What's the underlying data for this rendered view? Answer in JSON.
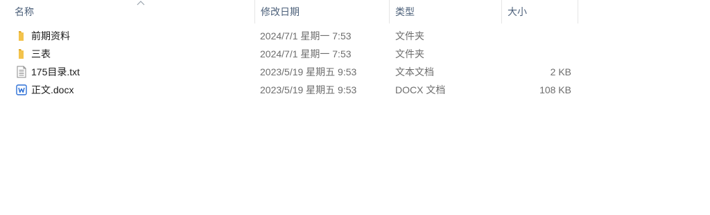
{
  "columns": {
    "name": "名称",
    "date": "修改日期",
    "type": "类型",
    "size": "大小"
  },
  "sort_indicator": "chevron-up-icon",
  "files": [
    {
      "name": "前期资料",
      "date": "2024/7/1 星期一 7:53",
      "type": "文件夹",
      "size": "",
      "icon": "folder-icon"
    },
    {
      "name": "三表",
      "date": "2024/7/1 星期一 7:53",
      "type": "文件夹",
      "size": "",
      "icon": "folder-icon"
    },
    {
      "name": "175目录.txt",
      "date": "2023/5/19 星期五 9:53",
      "type": "文本文档",
      "size": "2 KB",
      "icon": "text-file-icon"
    },
    {
      "name": "正文.docx",
      "date": "2023/5/19 星期五 9:53",
      "type": "DOCX 文档",
      "size": "108 KB",
      "icon": "word-document-icon"
    }
  ],
  "colors": {
    "folder": "#f3c34c",
    "word_accent": "#2b6fd6",
    "header_text": "#4c607a"
  }
}
